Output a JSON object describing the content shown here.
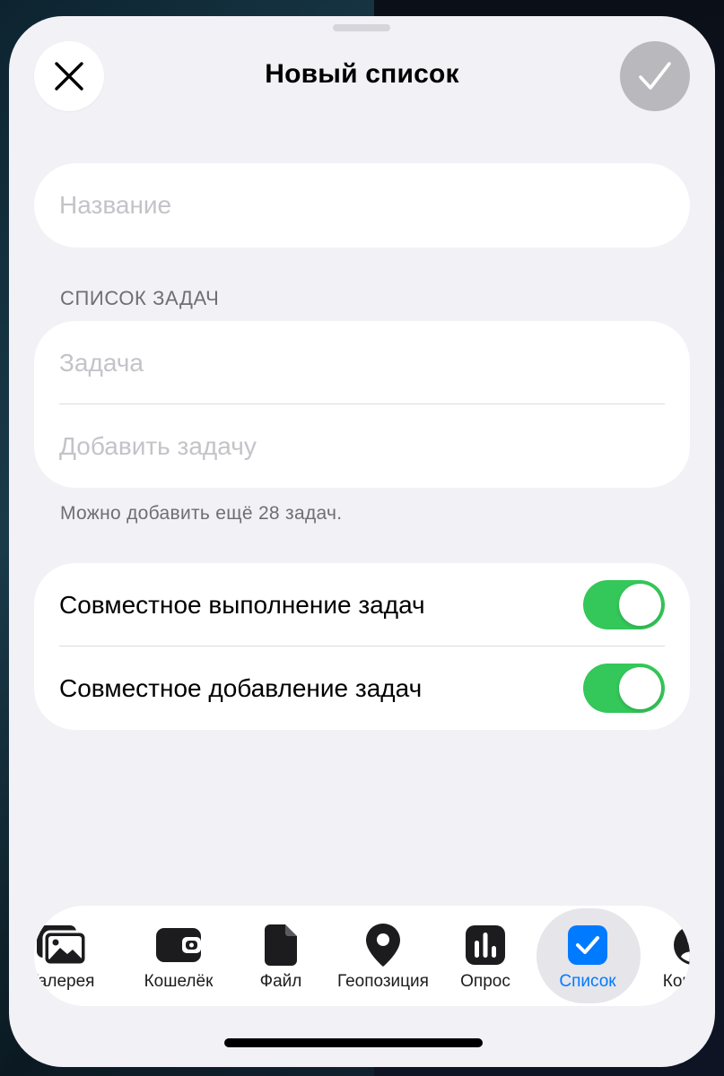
{
  "header": {
    "title": "Новый список",
    "close_icon": "close-icon",
    "done_icon": "checkmark-icon"
  },
  "name_field": {
    "placeholder": "Название",
    "value": ""
  },
  "tasks_section": {
    "label": "СПИСОК ЗАДАЧ",
    "task_placeholder": "Задача",
    "add_task_placeholder": "Добавить задачу",
    "hint": "Можно добавить ещё 28 задач."
  },
  "settings": {
    "shared_completion": {
      "label": "Совместное выполнение задач",
      "on": true
    },
    "shared_adding": {
      "label": "Совместное добавление задач",
      "on": true
    }
  },
  "attach_bar": {
    "items": [
      {
        "label": "Галерея",
        "icon": "gallery-icon"
      },
      {
        "label": "Кошелёк",
        "icon": "wallet-icon"
      },
      {
        "label": "Файл",
        "icon": "file-icon"
      },
      {
        "label": "Геопозиция",
        "icon": "location-pin-icon"
      },
      {
        "label": "Опрос",
        "icon": "poll-icon"
      },
      {
        "label": "Список",
        "icon": "checklist-icon",
        "selected": true
      },
      {
        "label": "Контакт",
        "icon": "contact-icon"
      }
    ]
  },
  "colors": {
    "accent": "#007aff",
    "toggle_on": "#34c759",
    "done_button_disabled": "#b8b8bd",
    "sheet_background": "#f1f1f6"
  }
}
